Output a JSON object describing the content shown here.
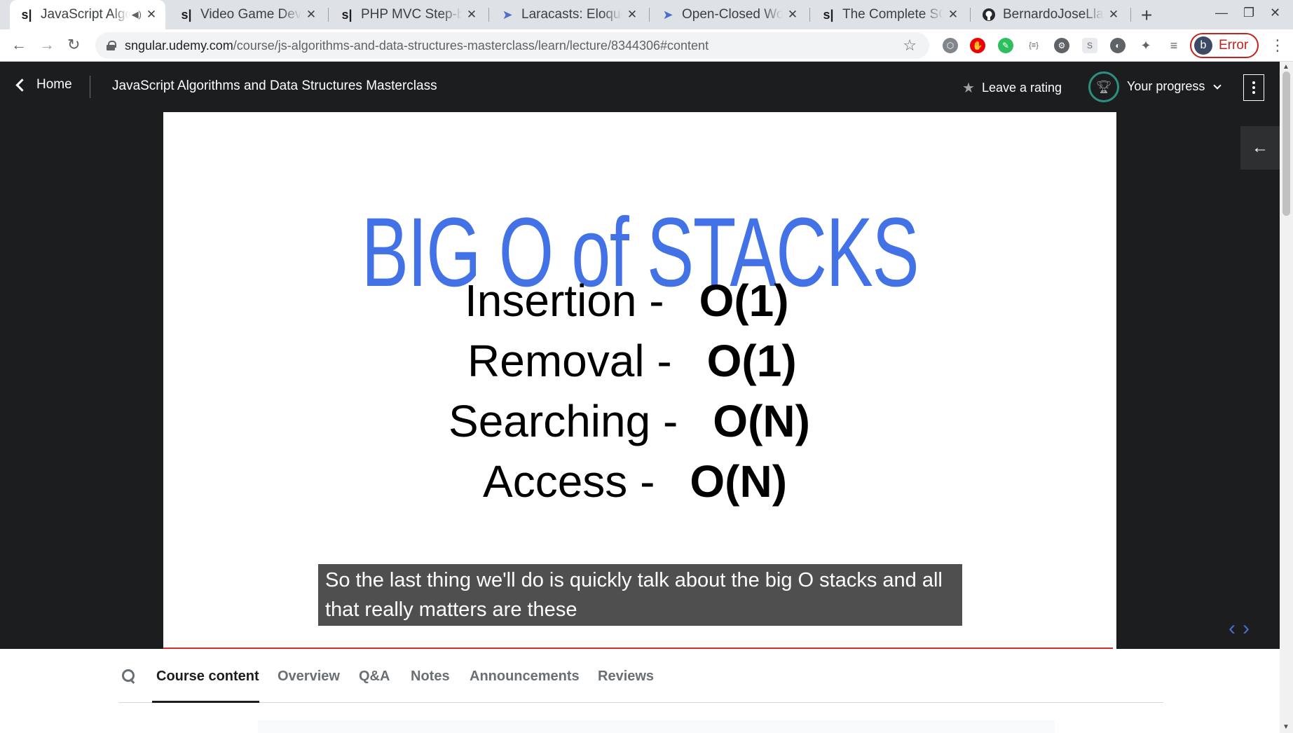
{
  "browser": {
    "tabs": [
      {
        "title": "JavaScript Algorithms and Data Structures Masterclass",
        "favicon": "s|",
        "audio_icon": "speaker-icon",
        "active": true
      },
      {
        "title": "Video Game Development",
        "favicon": "s|"
      },
      {
        "title": "PHP MVC Step-by-Step",
        "favicon": "s|"
      },
      {
        "title": "Laracasts: Eloquent",
        "favicon": "paper-plane-icon"
      },
      {
        "title": "Open-Closed Workflow",
        "favicon": "paper-plane-icon"
      },
      {
        "title": "The Complete SQL",
        "favicon": "s|"
      },
      {
        "title": "BernardoJoseLlamas",
        "favicon": "github-icon"
      }
    ],
    "url_host": "sngular.udemy.com",
    "url_path": "/course/js-algorithms-and-data-structures-masterclass/learn/lecture/8344306#content",
    "profile_initial": "b",
    "profile_status": "Error",
    "colors": {
      "error": "#c5221f",
      "tabstrip": "#dee1e6"
    }
  },
  "header": {
    "home_label": "Home",
    "course_title": "JavaScript Algorithms and Data Structures Masterclass",
    "leave_rating": "Leave a rating",
    "your_progress": "Your progress"
  },
  "slide": {
    "title": "BIG O of STACKS",
    "rows": [
      {
        "label": "Insertion -",
        "value": "O(1)"
      },
      {
        "label": "Removal -",
        "value": "O(1)"
      },
      {
        "label": "Searching -",
        "value": "O(N)"
      },
      {
        "label": "Access -",
        "value": "O(N)"
      }
    ],
    "title_color": "#4272e6"
  },
  "caption": "So the last thing we'll do is quickly talk about the big O stacks and all that really matters are these",
  "course_tabs": [
    "Course content",
    "Overview",
    "Q&A",
    "Notes",
    "Announcements",
    "Reviews"
  ],
  "active_course_tab": "Course content"
}
